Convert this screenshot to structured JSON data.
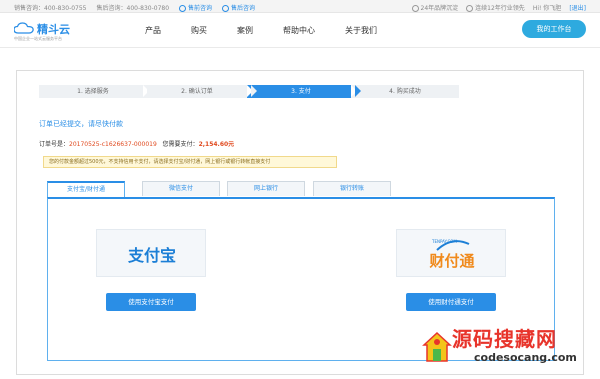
{
  "topbar": {
    "sales_phone": "销售咨询：400-830-0755",
    "presales_phone": "售后咨询：400-830-0780",
    "presales_chat": "售前咨询",
    "aftersales_chat": "售后咨询",
    "brand_badge": "24年品牌沉淀",
    "industry_badge": "连续12年行业领先",
    "user_greeting": "Hi! 你飞胆",
    "logout": "[退出]"
  },
  "header": {
    "logo_name": "精斗云",
    "logo_tagline": "中国企业一站式云服务平台",
    "nav": [
      "产品",
      "购买",
      "案例",
      "帮助中心",
      "关于我们"
    ],
    "workspace_button": "我的工作台"
  },
  "steps": [
    {
      "label": "1. 选择服务",
      "active": false
    },
    {
      "label": "2. 确认订单",
      "active": false
    },
    {
      "label": "3. 支付",
      "active": true
    },
    {
      "label": "4. 购买成功",
      "active": false
    }
  ],
  "order": {
    "submitted_msg": "订单已经提交，请尽快付款",
    "order_no_label": "订单号是：",
    "order_no": "20170525-c1626637-000019",
    "amount_label": "您需要支付：",
    "amount": "2,154.60元"
  },
  "notice": "您的付款金额超过500元，不支持信用卡支付，请选择支付宝/财付通，网上银行或银行转帐直接支付",
  "tabs": [
    "支付宝/财付通",
    "微信支付",
    "网上银行",
    "银行转账"
  ],
  "payments": {
    "alipay_logo": "支付宝",
    "alipay_button": "使用支付宝支付",
    "tenpay_logo": "财付通",
    "tenpay_logo_small": "TENPAY.COM",
    "tenpay_button": "使用财付通支付"
  },
  "watermark": {
    "title": "源码搜藏网",
    "url": "codesocang.com"
  },
  "colors": {
    "accent": "#2a8ee6",
    "price": "#e04a1f",
    "watermark_red": "#e8342b"
  }
}
